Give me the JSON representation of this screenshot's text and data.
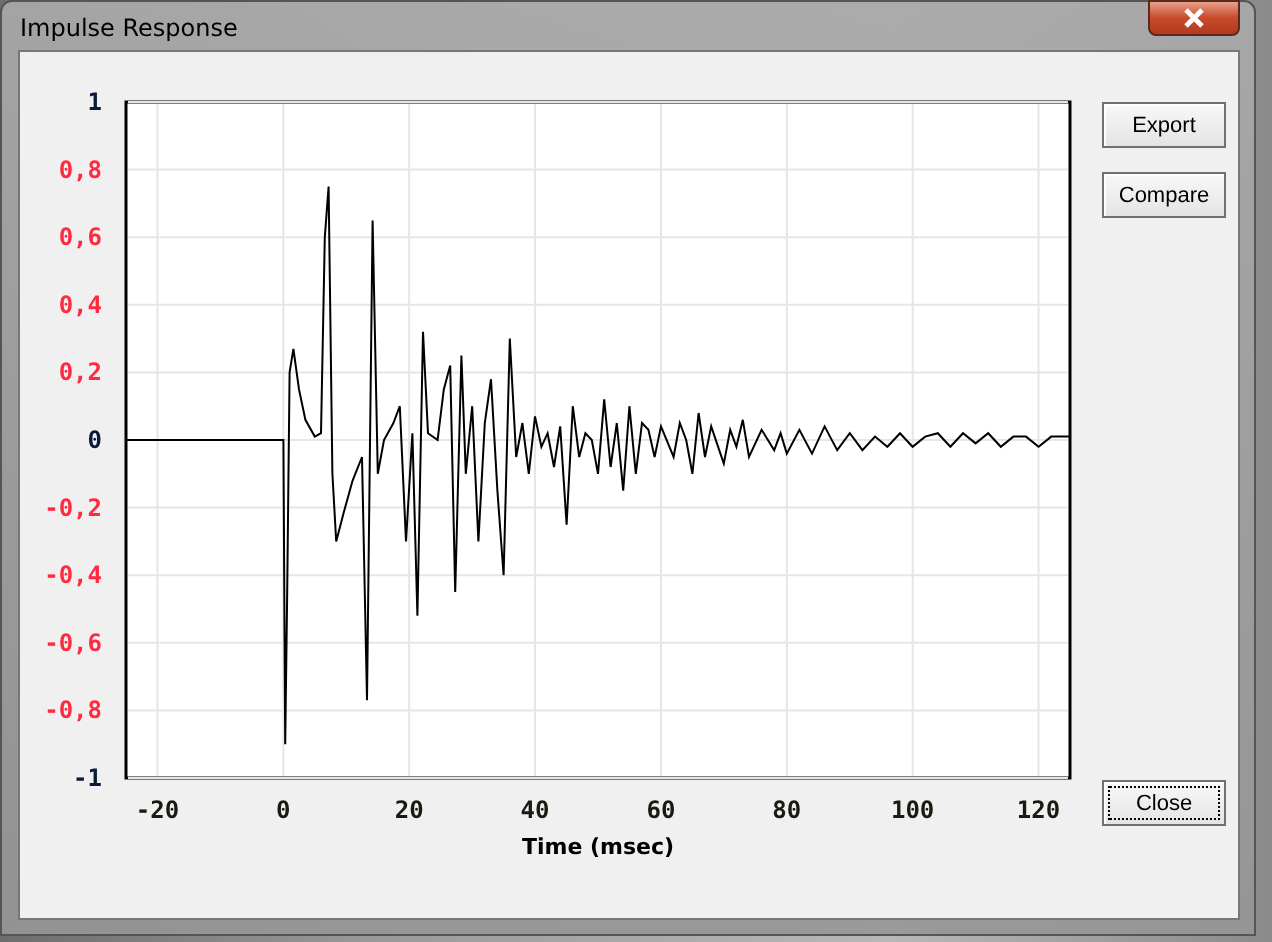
{
  "window": {
    "title": "Impulse Response"
  },
  "chart": {
    "chart_data": {
      "type": "line",
      "grid": true,
      "xlabel": "Time (msec)",
      "xlim": [
        -25,
        125
      ],
      "ylim": [
        -1,
        1
      ],
      "xticks": [
        -20,
        0,
        20,
        40,
        60,
        80,
        100,
        120
      ],
      "yticks": [
        {
          "value": 1,
          "label": "1"
        },
        {
          "value": 0.8,
          "label": "0,8"
        },
        {
          "value": 0.6,
          "label": "0,6"
        },
        {
          "value": 0.4,
          "label": "0,4"
        },
        {
          "value": 0.2,
          "label": "0,2"
        },
        {
          "value": 0,
          "label": "0"
        },
        {
          "value": -0.2,
          "label": "-0,2"
        },
        {
          "value": -0.4,
          "label": "-0,4"
        },
        {
          "value": -0.6,
          "label": "-0,6"
        },
        {
          "value": -0.8,
          "label": "-0,8"
        },
        {
          "value": -1,
          "label": "-1"
        }
      ],
      "x": [
        -25,
        0,
        0.3,
        0.6,
        1,
        1.6,
        2.5,
        3.5,
        5,
        6,
        6.6,
        7.2,
        7.8,
        8.4,
        9.5,
        11,
        12.5,
        13.3,
        14.2,
        15,
        16,
        17.5,
        18.5,
        19.5,
        20.5,
        21.3,
        22.2,
        23,
        24.5,
        25.5,
        26.5,
        27.3,
        28.3,
        29,
        30,
        31,
        32,
        33,
        34,
        35,
        36,
        37,
        38,
        39,
        40,
        41,
        42,
        43,
        44,
        45,
        46,
        47,
        48,
        49,
        50,
        51,
        52,
        53,
        54,
        55,
        56,
        57,
        58,
        59,
        60,
        62,
        63,
        64,
        65,
        66,
        67,
        68,
        70,
        71,
        72,
        73,
        74,
        76,
        78,
        79,
        80,
        82,
        84,
        86,
        88,
        90,
        92,
        94,
        96,
        98,
        100,
        102,
        104,
        106,
        108,
        110,
        112,
        114,
        116,
        118,
        120,
        122,
        125
      ],
      "series": [
        {
          "color": "#000000",
          "values": [
            0,
            0,
            -0.9,
            -0.45,
            0.2,
            0.27,
            0.15,
            0.06,
            0.01,
            0.02,
            0.6,
            0.75,
            -0.1,
            -0.3,
            -0.22,
            -0.12,
            -0.05,
            -0.77,
            0.65,
            -0.1,
            0,
            0.05,
            0.1,
            -0.3,
            0.02,
            -0.52,
            0.32,
            0.02,
            0,
            0.15,
            0.22,
            -0.45,
            0.25,
            -0.1,
            0.1,
            -0.3,
            0.05,
            0.18,
            -0.15,
            -0.4,
            0.3,
            -0.05,
            0.05,
            -0.1,
            0.07,
            -0.02,
            0.02,
            -0.08,
            0.04,
            -0.25,
            0.1,
            -0.05,
            0.02,
            0,
            -0.1,
            0.12,
            -0.08,
            0.05,
            -0.15,
            0.1,
            -0.1,
            0.05,
            0.03,
            -0.05,
            0.04,
            -0.05,
            0.05,
            0,
            -0.1,
            0.08,
            -0.05,
            0.04,
            -0.07,
            0.03,
            -0.02,
            0.06,
            -0.05,
            0.03,
            -0.03,
            0.02,
            -0.04,
            0.03,
            -0.04,
            0.04,
            -0.03,
            0.02,
            -0.03,
            0.01,
            -0.02,
            0.02,
            -0.02,
            0.01,
            0.02,
            -0.02,
            0.02,
            -0.01,
            0.02,
            -0.02,
            0.01,
            0.01,
            -0.02,
            0.01,
            0.01
          ]
        }
      ]
    }
  },
  "buttons": [
    {
      "label": "Export",
      "focused": false
    },
    {
      "label": "Compare",
      "focused": false
    }
  ],
  "footer_button": {
    "label": "Close",
    "focused": true
  }
}
